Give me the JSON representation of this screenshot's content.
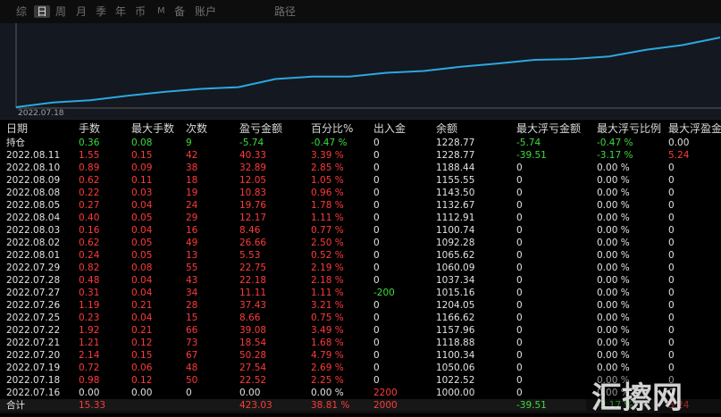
{
  "tabs": [
    "综",
    "日",
    "周",
    "月",
    "季",
    "年",
    "币",
    "M",
    "备",
    "账户",
    "路径"
  ],
  "active_tab": 1,
  "chart": {
    "start_date": "2022.07.18",
    "line_color": "#2aa8e0",
    "balance_series": [
      1000.0,
      1022.52,
      1050.06,
      1100.34,
      1118.88,
      1157.96,
      1166.62,
      1204.05,
      1015.16,
      1037.34,
      1060.09,
      1065.62,
      1092.28,
      1100.74,
      1112.91,
      1132.67,
      1143.5,
      1155.55,
      1188.44,
      1228.77
    ]
  },
  "columns": [
    "日期",
    "手数",
    "最大手数",
    "次数",
    "盈亏金额",
    "百分比%",
    "出入金",
    "余额",
    "最大浮亏金额",
    "最大浮亏比例",
    "最大浮盈金"
  ],
  "rows": [
    {
      "date": "持仓",
      "lots": "0.36",
      "max_lots": "0.08",
      "count": "9",
      "pnl": "-5.74",
      "pct": "-0.47 %",
      "flow": "0",
      "balance": "1228.77",
      "max_float_loss": "-5.74",
      "max_float_loss_pct": "-0.47 %",
      "max_float_gain": "0.00",
      "kind": "position"
    },
    {
      "date": "2022.08.11",
      "lots": "1.55",
      "max_lots": "0.15",
      "count": "42",
      "pnl": "40.33",
      "pct": "3.39 %",
      "flow": "0",
      "balance": "1228.77",
      "max_float_loss": "-39.51",
      "max_float_loss_pct": "-3.17 %",
      "max_float_gain": "5.24",
      "kind": "day"
    },
    {
      "date": "2022.08.10",
      "lots": "0.89",
      "max_lots": "0.09",
      "count": "38",
      "pnl": "32.89",
      "pct": "2.85 %",
      "flow": "0",
      "balance": "1188.44",
      "max_float_loss": "0",
      "max_float_loss_pct": "0.00 %",
      "max_float_gain": "0",
      "kind": "day"
    },
    {
      "date": "2022.08.09",
      "lots": "0.62",
      "max_lots": "0.11",
      "count": "18",
      "pnl": "12.05",
      "pct": "1.05 %",
      "flow": "0",
      "balance": "1155.55",
      "max_float_loss": "0",
      "max_float_loss_pct": "0.00 %",
      "max_float_gain": "0",
      "kind": "day"
    },
    {
      "date": "2022.08.08",
      "lots": "0.22",
      "max_lots": "0.03",
      "count": "19",
      "pnl": "10.83",
      "pct": "0.96 %",
      "flow": "0",
      "balance": "1143.50",
      "max_float_loss": "0",
      "max_float_loss_pct": "0.00 %",
      "max_float_gain": "0",
      "kind": "day"
    },
    {
      "date": "2022.08.05",
      "lots": "0.27",
      "max_lots": "0.04",
      "count": "24",
      "pnl": "19.76",
      "pct": "1.78 %",
      "flow": "0",
      "balance": "1132.67",
      "max_float_loss": "0",
      "max_float_loss_pct": "0.00 %",
      "max_float_gain": "0",
      "kind": "day"
    },
    {
      "date": "2022.08.04",
      "lots": "0.40",
      "max_lots": "0.05",
      "count": "29",
      "pnl": "12.17",
      "pct": "1.11 %",
      "flow": "0",
      "balance": "1112.91",
      "max_float_loss": "0",
      "max_float_loss_pct": "0.00 %",
      "max_float_gain": "0",
      "kind": "day"
    },
    {
      "date": "2022.08.03",
      "lots": "0.16",
      "max_lots": "0.04",
      "count": "16",
      "pnl": "8.46",
      "pct": "0.77 %",
      "flow": "0",
      "balance": "1100.74",
      "max_float_loss": "0",
      "max_float_loss_pct": "0.00 %",
      "max_float_gain": "0",
      "kind": "day"
    },
    {
      "date": "2022.08.02",
      "lots": "0.62",
      "max_lots": "0.05",
      "count": "49",
      "pnl": "26.66",
      "pct": "2.50 %",
      "flow": "0",
      "balance": "1092.28",
      "max_float_loss": "0",
      "max_float_loss_pct": "0.00 %",
      "max_float_gain": "0",
      "kind": "day"
    },
    {
      "date": "2022.08.01",
      "lots": "0.24",
      "max_lots": "0.05",
      "count": "13",
      "pnl": "5.53",
      "pct": "0.52 %",
      "flow": "0",
      "balance": "1065.62",
      "max_float_loss": "0",
      "max_float_loss_pct": "0.00 %",
      "max_float_gain": "0",
      "kind": "day"
    },
    {
      "date": "2022.07.29",
      "lots": "0.82",
      "max_lots": "0.08",
      "count": "55",
      "pnl": "22.75",
      "pct": "2.19 %",
      "flow": "0",
      "balance": "1060.09",
      "max_float_loss": "0",
      "max_float_loss_pct": "0.00 %",
      "max_float_gain": "0",
      "kind": "day"
    },
    {
      "date": "2022.07.28",
      "lots": "0.48",
      "max_lots": "0.04",
      "count": "43",
      "pnl": "22.18",
      "pct": "2.18 %",
      "flow": "0",
      "balance": "1037.34",
      "max_float_loss": "0",
      "max_float_loss_pct": "0.00 %",
      "max_float_gain": "0",
      "kind": "day"
    },
    {
      "date": "2022.07.27",
      "lots": "0.31",
      "max_lots": "0.04",
      "count": "34",
      "pnl": "11.11",
      "pct": "1.11 %",
      "flow": "-200",
      "balance": "1015.16",
      "max_float_loss": "0",
      "max_float_loss_pct": "0.00 %",
      "max_float_gain": "0",
      "kind": "day"
    },
    {
      "date": "2022.07.26",
      "lots": "1.19",
      "max_lots": "0.21",
      "count": "28",
      "pnl": "37.43",
      "pct": "3.21 %",
      "flow": "0",
      "balance": "1204.05",
      "max_float_loss": "0",
      "max_float_loss_pct": "0.00 %",
      "max_float_gain": "0",
      "kind": "day"
    },
    {
      "date": "2022.07.25",
      "lots": "0.23",
      "max_lots": "0.04",
      "count": "15",
      "pnl": "8.66",
      "pct": "0.75 %",
      "flow": "0",
      "balance": "1166.62",
      "max_float_loss": "0",
      "max_float_loss_pct": "0.00 %",
      "max_float_gain": "0",
      "kind": "day"
    },
    {
      "date": "2022.07.22",
      "lots": "1.92",
      "max_lots": "0.21",
      "count": "66",
      "pnl": "39.08",
      "pct": "3.49 %",
      "flow": "0",
      "balance": "1157.96",
      "max_float_loss": "0",
      "max_float_loss_pct": "0.00 %",
      "max_float_gain": "0",
      "kind": "day"
    },
    {
      "date": "2022.07.21",
      "lots": "1.21",
      "max_lots": "0.12",
      "count": "73",
      "pnl": "18.54",
      "pct": "1.68 %",
      "flow": "0",
      "balance": "1118.88",
      "max_float_loss": "0",
      "max_float_loss_pct": "0.00 %",
      "max_float_gain": "0",
      "kind": "day"
    },
    {
      "date": "2022.07.20",
      "lots": "2.14",
      "max_lots": "0.15",
      "count": "67",
      "pnl": "50.28",
      "pct": "4.79 %",
      "flow": "0",
      "balance": "1100.34",
      "max_float_loss": "0",
      "max_float_loss_pct": "0.00 %",
      "max_float_gain": "0",
      "kind": "day"
    },
    {
      "date": "2022.07.19",
      "lots": "0.72",
      "max_lots": "0.06",
      "count": "48",
      "pnl": "27.54",
      "pct": "2.69 %",
      "flow": "0",
      "balance": "1050.06",
      "max_float_loss": "0",
      "max_float_loss_pct": "0.00 %",
      "max_float_gain": "0",
      "kind": "day"
    },
    {
      "date": "2022.07.18",
      "lots": "0.98",
      "max_lots": "0.12",
      "count": "50",
      "pnl": "22.52",
      "pct": "2.25 %",
      "flow": "0",
      "balance": "1022.52",
      "max_float_loss": "0",
      "max_float_loss_pct": "0.00 %",
      "max_float_gain": "0",
      "kind": "day"
    },
    {
      "date": "2022.07.16",
      "lots": "0.00",
      "max_lots": "0.00",
      "count": "0",
      "pnl": "0.00",
      "pct": "0.00 %",
      "flow": "2200",
      "balance": "1000.00",
      "max_float_loss": "0",
      "max_float_loss_pct": "0.00 %",
      "max_float_gain": "0",
      "kind": "start"
    },
    {
      "date": "合计",
      "lots": "15.33",
      "max_lots": "",
      "count": "",
      "pnl": "423.03",
      "pct": "38.81 %",
      "flow": "2000",
      "balance": "",
      "max_float_loss": "-39.51",
      "max_float_loss_pct": "-3.17 %",
      "max_float_gain": "5.24",
      "kind": "total"
    }
  ],
  "watermark": "汇擦网"
}
